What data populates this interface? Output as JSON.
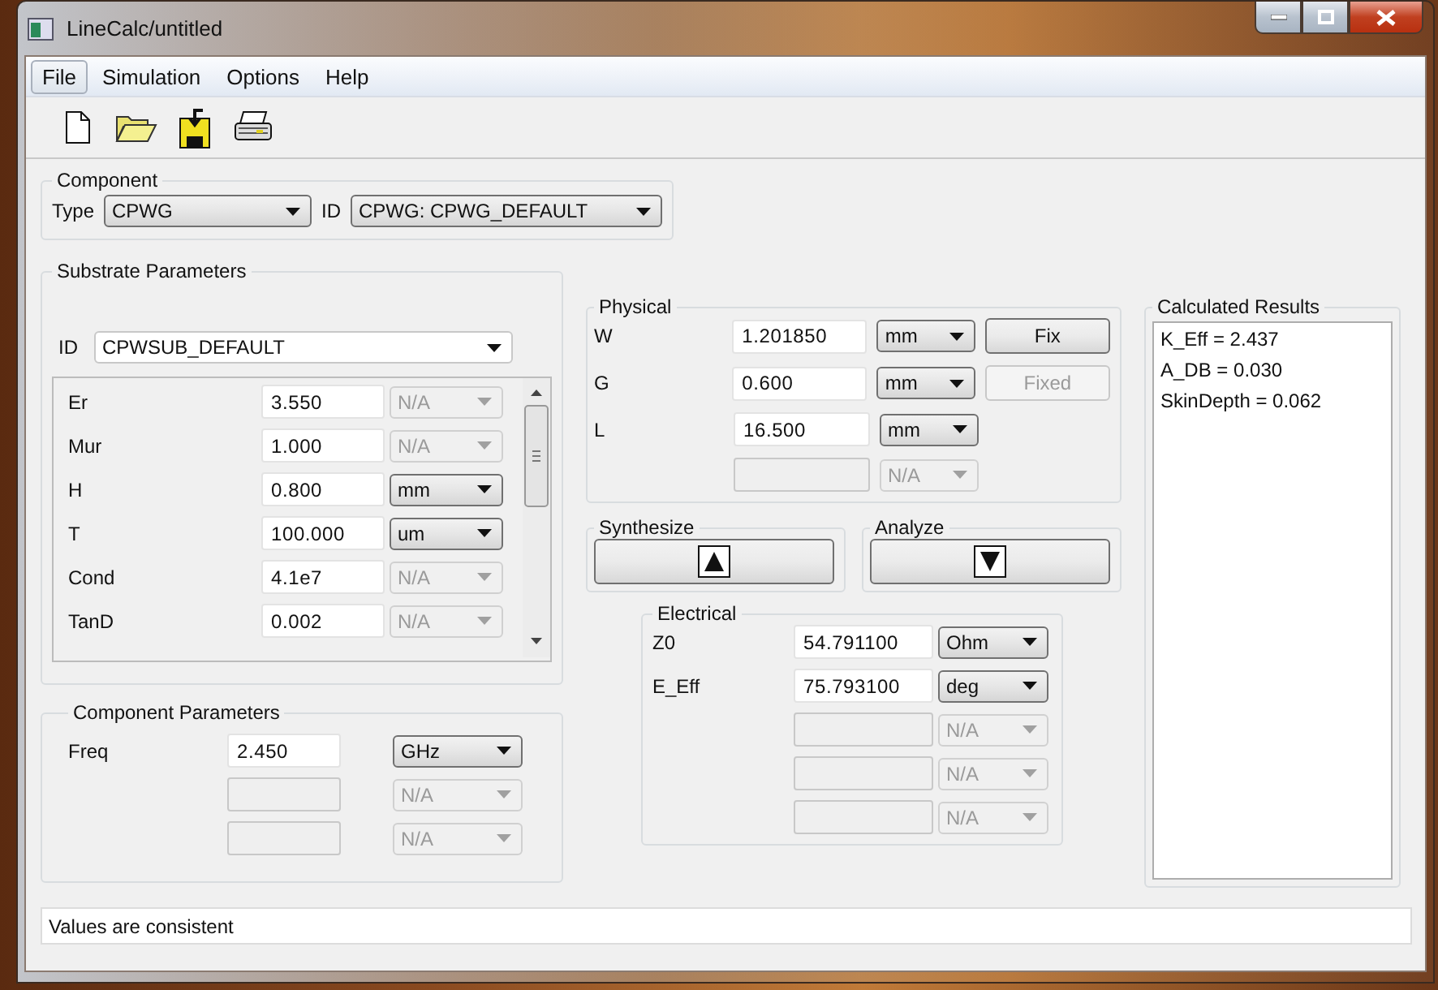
{
  "window": {
    "title": "LineCalc/untitled"
  },
  "menu": [
    {
      "label": "File",
      "selected": true
    },
    {
      "label": "Simulation",
      "selected": false
    },
    {
      "label": "Options",
      "selected": false
    },
    {
      "label": "Help",
      "selected": false
    }
  ],
  "toolbar": [
    {
      "kind": "new"
    },
    {
      "kind": "open"
    },
    {
      "kind": "save"
    },
    {
      "kind": "print"
    }
  ],
  "component": {
    "title": "Component",
    "type_label": "Type",
    "type": "CPWG",
    "id_label": "ID",
    "id": "CPWG: CPWG_DEFAULT"
  },
  "substrate": {
    "title": "Substrate Parameters",
    "id_label": "ID",
    "id": "CPWSUB_DEFAULT",
    "rows": [
      {
        "label": "Er",
        "value": "3.550",
        "input_disabled": false,
        "unit": "N/A",
        "unit_disabled": true
      },
      {
        "label": "Mur",
        "value": "1.000",
        "input_disabled": false,
        "unit": "N/A",
        "unit_disabled": true
      },
      {
        "label": "H",
        "value": "0.800",
        "input_disabled": false,
        "unit": "mm",
        "unit_disabled": false
      },
      {
        "label": "T",
        "value": "100.000",
        "input_disabled": false,
        "unit": "um",
        "unit_disabled": false
      },
      {
        "label": "Cond",
        "value": "4.1e7",
        "input_disabled": false,
        "unit": "N/A",
        "unit_disabled": true
      },
      {
        "label": "TanD",
        "value": "0.002",
        "input_disabled": false,
        "unit": "N/A",
        "unit_disabled": true
      }
    ]
  },
  "component_parameters": {
    "title": "Component Parameters",
    "rows": [
      {
        "label": "Freq",
        "value": "2.450",
        "input_disabled": false,
        "unit": "GHz",
        "unit_disabled": false
      },
      {
        "input_disabled": true,
        "unit": "N/A",
        "unit_disabled": true
      },
      {
        "input_disabled": true,
        "unit": "N/A",
        "unit_disabled": true
      }
    ]
  },
  "physical": {
    "title": "Physical",
    "rows": [
      {
        "label": "W",
        "value": "1.201850",
        "input_disabled": false,
        "unit": "mm",
        "unit_disabled": false,
        "button": {
          "label": "Fix",
          "disabled": false
        }
      },
      {
        "label": "G",
        "value": "0.600",
        "input_disabled": false,
        "unit": "mm",
        "unit_disabled": false,
        "button": {
          "label": "Fixed",
          "disabled": true
        }
      },
      {
        "label": "L",
        "value": "16.500",
        "input_disabled": false,
        "unit": "mm",
        "unit_disabled": false
      },
      {
        "input_disabled": true,
        "unit": "N/A",
        "unit_disabled": true
      }
    ]
  },
  "actions": [
    {
      "title": "Synthesize",
      "kind": "up"
    },
    {
      "title": "Analyze",
      "kind": "down"
    }
  ],
  "electrical": {
    "title": "Electrical",
    "rows": [
      {
        "label": "Z0",
        "value": "54.791100",
        "input_disabled": false,
        "unit": "Ohm",
        "unit_disabled": false
      },
      {
        "label": "E_Eff",
        "value": "75.793100",
        "input_disabled": false,
        "unit": "deg",
        "unit_disabled": false
      },
      {
        "input_disabled": true,
        "unit": "N/A",
        "unit_disabled": true
      },
      {
        "input_disabled": true,
        "unit": "N/A",
        "unit_disabled": true
      },
      {
        "input_disabled": true,
        "unit": "N/A",
        "unit_disabled": true
      }
    ]
  },
  "results": {
    "title": "Calculated Results",
    "lines": [
      "K_Eff = 2.437",
      "A_DB = 0.030",
      "SkinDepth = 0.062"
    ]
  },
  "status_bar": "Values are consistent"
}
